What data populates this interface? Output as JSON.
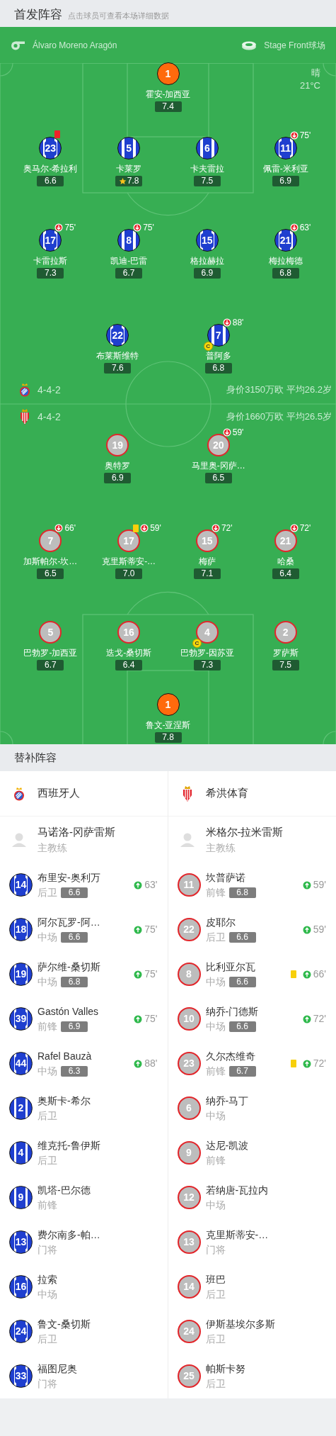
{
  "lineups": {
    "title": "首发阵容",
    "hint": "点击球员可查看本场详细数据",
    "referee": "Álvaro Moreno Aragón",
    "venue": "Stage Front球场",
    "weather": "晴",
    "temperature": "21°C",
    "teams": [
      {
        "kind": "striped",
        "formation": "4-4-2",
        "summary": "身价3150万欧 平均26.2岁",
        "rows": [
          {
            "players": [
              {
                "kind": "keeper",
                "number": "1",
                "name": "霍安-加西亚",
                "rating": "7.4",
                "motm": false
              }
            ]
          },
          {
            "players": [
              {
                "kind": "outfield",
                "number": "23",
                "name": "奥马尔-希拉利",
                "rating": "6.6",
                "motm": false,
                "red_card": true
              },
              {
                "kind": "outfield",
                "number": "5",
                "name": "卡莱罗",
                "rating": "7.8",
                "motm": true
              },
              {
                "kind": "outfield",
                "number": "6",
                "name": "卡夫雷拉",
                "rating": "7.5",
                "motm": false
              },
              {
                "kind": "outfield",
                "number": "11",
                "name": "佩雷-米利亚",
                "rating": "6.9",
                "motm": false,
                "sub_out": "75'"
              }
            ]
          },
          {
            "players": [
              {
                "kind": "outfield",
                "number": "17",
                "name": "卡雷拉斯",
                "rating": "7.3",
                "motm": false,
                "sub_out": "75'"
              },
              {
                "kind": "outfield",
                "number": "8",
                "name": "凯迪-巴雷",
                "rating": "6.7",
                "motm": false,
                "sub_out": "75'"
              },
              {
                "kind": "outfield",
                "number": "15",
                "name": "格拉赫拉",
                "rating": "6.9",
                "motm": false
              },
              {
                "kind": "outfield",
                "number": "21",
                "name": "梅拉梅德",
                "rating": "6.8",
                "motm": false,
                "sub_out": "63'"
              }
            ]
          },
          {
            "players": [
              {
                "kind": "outfield",
                "number": "22",
                "name": "布莱斯维特",
                "rating": "7.6",
                "motm": false
              },
              {
                "kind": "outfield",
                "number": "7",
                "name": "普阿多",
                "rating": "6.8",
                "motm": false,
                "captain_mark": "C",
                "sub_out": "88'"
              }
            ]
          }
        ]
      },
      {
        "kind": "plain",
        "formation": "4-4-2",
        "summary": "身价1660万欧 平均26.5岁",
        "rows": [
          {
            "players": [
              {
                "kind": "outfield",
                "number": "19",
                "name": "奥特罗",
                "rating": "6.9",
                "motm": false
              },
              {
                "kind": "outfield",
                "number": "20",
                "name": "马里奥-冈萨…",
                "rating": "6.5",
                "motm": false,
                "sub_out": "59'"
              }
            ]
          },
          {
            "players": [
              {
                "kind": "outfield",
                "number": "7",
                "name": "加斯帕尔-坎…",
                "rating": "6.5",
                "motm": false,
                "sub_out": "66'"
              },
              {
                "kind": "outfield",
                "number": "17",
                "name": "克里斯蒂安-…",
                "rating": "7.0",
                "motm": false,
                "yellow_card": true,
                "sub_out": "59'"
              },
              {
                "kind": "outfield",
                "number": "15",
                "name": "梅萨",
                "rating": "7.1",
                "motm": false,
                "sub_out": "72'"
              },
              {
                "kind": "outfield",
                "number": "21",
                "name": "哈桑",
                "rating": "6.4",
                "motm": false,
                "sub_out": "72'"
              }
            ]
          },
          {
            "players": [
              {
                "kind": "outfield",
                "number": "5",
                "name": "巴勃罗-加西亚",
                "rating": "6.7",
                "motm": false
              },
              {
                "kind": "outfield",
                "number": "16",
                "name": "迭戈-桑切斯",
                "rating": "6.4",
                "motm": false
              },
              {
                "kind": "outfield",
                "number": "4",
                "name": "巴勃罗-因苏亚",
                "rating": "7.3",
                "motm": false,
                "captain_mark": "C"
              },
              {
                "kind": "outfield",
                "number": "2",
                "name": "罗萨斯",
                "rating": "7.5",
                "motm": false
              }
            ]
          },
          {
            "players": [
              {
                "kind": "keeper",
                "number": "1",
                "name": "鲁文-亚涅斯",
                "rating": "7.8",
                "motm": false
              }
            ]
          }
        ]
      }
    ]
  },
  "substitutes": {
    "title": "替补阵容",
    "teams": [
      {
        "name": "西班牙人",
        "kind": "striped",
        "coach": {
          "name": "马诺洛-冈萨雷斯",
          "role": "主教练"
        },
        "players": [
          {
            "number": "14",
            "name": "布里安-奥利万",
            "position": "后卫",
            "rating": "6.6",
            "sub_in": "63'"
          },
          {
            "number": "18",
            "name": "阿尔瓦罗-阿…",
            "position": "中场",
            "rating": "6.6",
            "sub_in": "75'"
          },
          {
            "number": "19",
            "name": "萨尔维-桑切斯",
            "position": "中场",
            "rating": "6.8",
            "sub_in": "75'"
          },
          {
            "number": "39",
            "name": "Gastón Valles",
            "position": "前锋",
            "rating": "6.9",
            "sub_in": "75'"
          },
          {
            "number": "44",
            "name": "Rafel Bauzà",
            "position": "中场",
            "rating": "6.3",
            "sub_in": "88'"
          },
          {
            "number": "2",
            "name": "奥斯卡-希尔",
            "position": "后卫"
          },
          {
            "number": "4",
            "name": "维克托-鲁伊斯",
            "position": "后卫"
          },
          {
            "number": "9",
            "name": "凯塔-巴尔德",
            "position": "前锋"
          },
          {
            "number": "13",
            "name": "费尔南多-帕…",
            "position": "门将"
          },
          {
            "number": "16",
            "name": "拉索",
            "position": "中场"
          },
          {
            "number": "24",
            "name": "鲁文-桑切斯",
            "position": "后卫"
          },
          {
            "number": "33",
            "name": "福图尼奥",
            "position": "门将"
          }
        ]
      },
      {
        "name": "希洪体育",
        "kind": "plain",
        "coach": {
          "name": "米格尔-拉米雷斯",
          "role": "主教练"
        },
        "players": [
          {
            "number": "11",
            "name": "坎普萨诺",
            "position": "前锋",
            "rating": "6.8",
            "sub_in": "59'"
          },
          {
            "number": "22",
            "name": "皮耶尔",
            "position": "后卫",
            "rating": "6.6",
            "sub_in": "59'"
          },
          {
            "number": "8",
            "name": "比利亚尔瓦",
            "position": "中场",
            "rating": "6.6",
            "yellow_card": true,
            "sub_in": "66'"
          },
          {
            "number": "10",
            "name": "纳乔-门德斯",
            "position": "中场",
            "rating": "6.6",
            "sub_in": "72'"
          },
          {
            "number": "23",
            "name": "久尔杰维奇",
            "position": "前锋",
            "rating": "6.7",
            "yellow_card": true,
            "sub_in": "72'"
          },
          {
            "number": "6",
            "name": "纳乔-马丁",
            "position": "中场"
          },
          {
            "number": "9",
            "name": "达尼-凯波",
            "position": "前锋"
          },
          {
            "number": "12",
            "name": "若纳唐-瓦拉内",
            "position": "中场"
          },
          {
            "number": "13",
            "name": "克里斯蒂安-…",
            "position": "门将"
          },
          {
            "number": "14",
            "name": "班巴",
            "position": "后卫"
          },
          {
            "number": "24",
            "name": "伊斯基埃尔多斯",
            "position": "后卫"
          },
          {
            "number": "25",
            "name": "帕斯卡努",
            "position": "后卫"
          }
        ]
      }
    ]
  }
}
